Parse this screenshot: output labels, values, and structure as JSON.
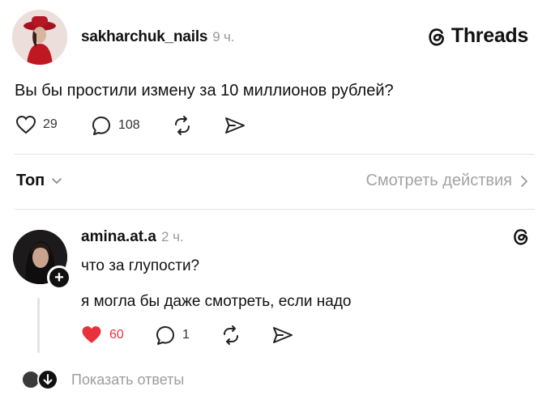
{
  "post": {
    "author": "sakharchuk_nails",
    "time": "9 ч.",
    "text": "Вы бы простили измену за 10 миллионов рублей?",
    "likes": "29",
    "replies": "108"
  },
  "brand": {
    "name": "Threads"
  },
  "sort": {
    "label": "Топ",
    "view_activity": "Смотреть действия"
  },
  "reply": {
    "author": "amina.at.a",
    "time": "2 ч.",
    "line1": "что за глупости?",
    "line2": "я могла бы даже смотреть, если надо",
    "likes": "60",
    "replies": "1",
    "liked": true
  },
  "show_replies": {
    "label": "Показать ответы"
  },
  "colors": {
    "like_active": "#e8303e",
    "muted": "#9a9a9a"
  }
}
